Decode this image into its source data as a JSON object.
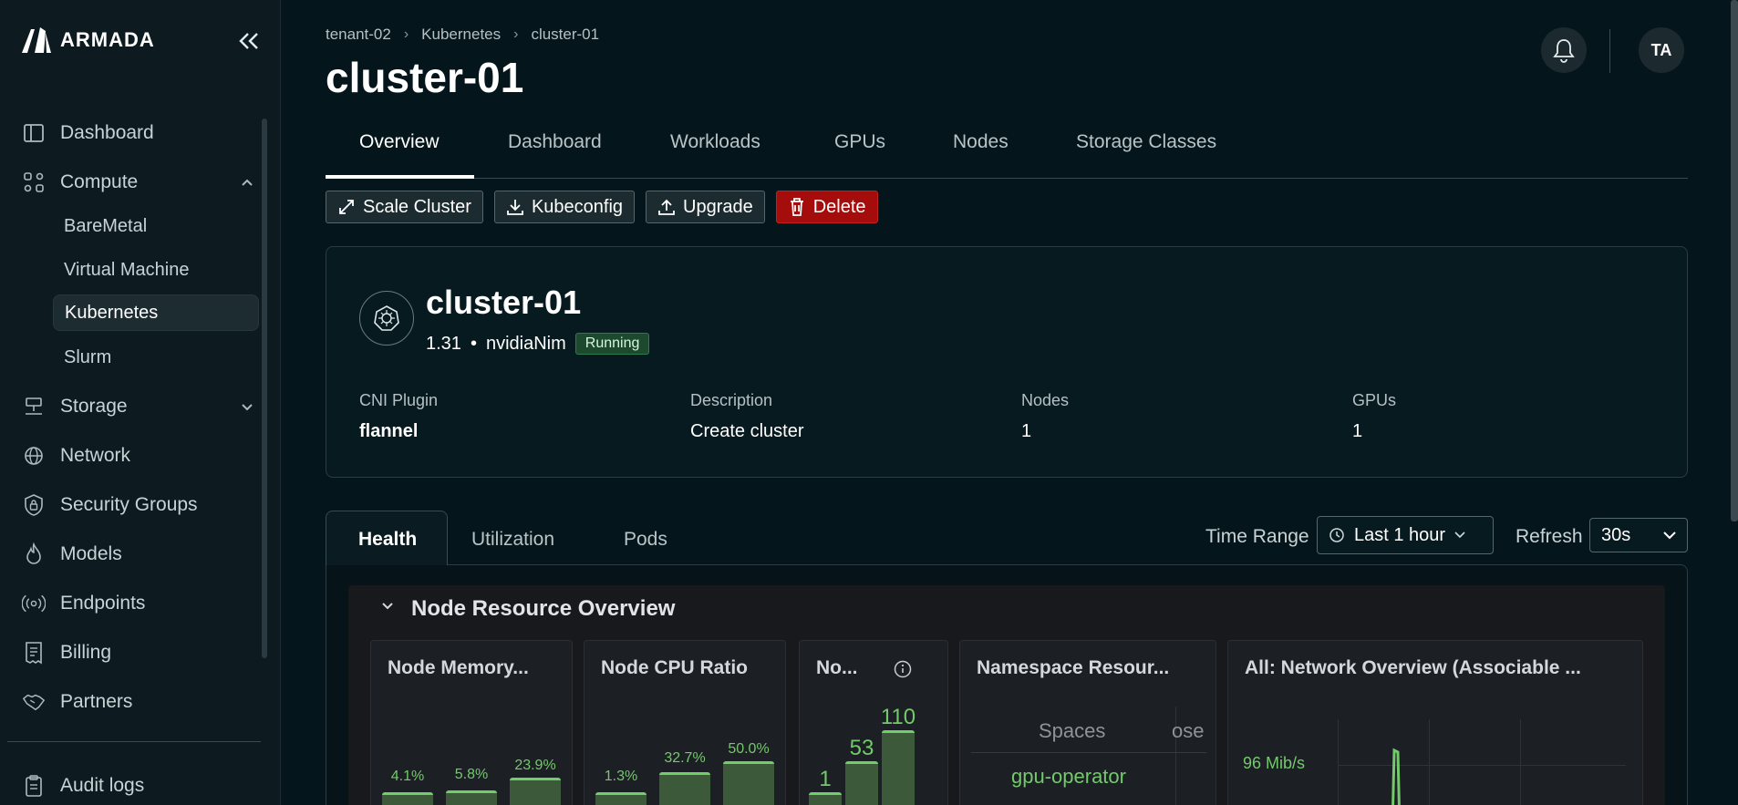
{
  "brand": {
    "name": "ARMADA"
  },
  "sidebar": {
    "items": [
      {
        "label": "Dashboard",
        "icon": "dashboard-icon"
      },
      {
        "label": "Compute",
        "icon": "compute-icon",
        "expanded": true
      },
      {
        "label": "Storage",
        "icon": "storage-icon",
        "expanded": false
      },
      {
        "label": "Network",
        "icon": "globe-icon"
      },
      {
        "label": "Security Groups",
        "icon": "shield-icon"
      },
      {
        "label": "Models",
        "icon": "flame-icon"
      },
      {
        "label": "Endpoints",
        "icon": "broadcast-icon"
      },
      {
        "label": "Billing",
        "icon": "receipt-icon"
      },
      {
        "label": "Partners",
        "icon": "handshake-icon"
      }
    ],
    "compute_sub": [
      {
        "label": "BareMetal"
      },
      {
        "label": "Virtual Machine"
      },
      {
        "label": "Kubernetes",
        "active": true
      },
      {
        "label": "Slurm"
      }
    ],
    "footer_item": {
      "label": "Audit logs",
      "icon": "clipboard-icon"
    }
  },
  "header": {
    "breadcrumb": [
      "tenant-02",
      "Kubernetes",
      "cluster-01"
    ],
    "title": "cluster-01",
    "avatar_initials": "TA"
  },
  "tabs": [
    "Overview",
    "Dashboard",
    "Workloads",
    "GPUs",
    "Nodes",
    "Storage Classes"
  ],
  "actions": {
    "scale": "Scale Cluster",
    "kubeconfig": "Kubeconfig",
    "upgrade": "Upgrade",
    "delete": "Delete"
  },
  "cluster": {
    "name": "cluster-01",
    "version": "1.31",
    "separator": "•",
    "type": "nvidiaNim",
    "status": "Running",
    "meta": [
      {
        "label": "CNI Plugin",
        "value": "flannel"
      },
      {
        "label": "Description",
        "value": "Create cluster"
      },
      {
        "label": "Nodes",
        "value": "1"
      },
      {
        "label": "GPUs",
        "value": "1"
      }
    ]
  },
  "subtabs": [
    "Health",
    "Utilization",
    "Pods"
  ],
  "filters": {
    "time_range_label": "Time Range",
    "time_range_value": "Last 1 hour",
    "refresh_label": "Refresh",
    "refresh_value": "30s"
  },
  "node_resource_overview": {
    "title": "Node Resource Overview",
    "cards": {
      "memory": {
        "title": "Node Memory...",
        "values": [
          "4.1%",
          "5.8%",
          "23.9%"
        ]
      },
      "cpu": {
        "title": "Node CPU Ratio",
        "values": [
          "1.3%",
          "32.7%",
          "50.0%"
        ]
      },
      "pods": {
        "title": "No...",
        "values": [
          "1",
          "53",
          "110"
        ]
      },
      "namespace": {
        "title": "Namespace Resour...",
        "col1": "Spaces",
        "col2": "ose",
        "row1": "gpu-operator"
      },
      "network": {
        "title": "All: Network Overview (Associable ...",
        "ylabel": "96 Mib/s"
      }
    }
  },
  "colors": {
    "accent_green": "#73c96b",
    "danger": "#a50d0d",
    "background": "#04161b"
  }
}
